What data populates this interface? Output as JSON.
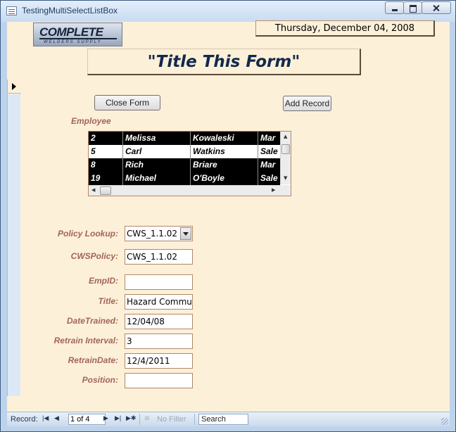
{
  "window": {
    "title": "TestingMultiSelectListBox"
  },
  "logo": {
    "main": "COMPLETE",
    "sub": "WELDERS SUPPLY"
  },
  "header": {
    "date": "Thursday, December 04, 2008",
    "form_title": "\"Title This Form\""
  },
  "buttons": {
    "close_form": "Close Form",
    "add_record": "Add Record"
  },
  "employee_list": {
    "label": "Employee",
    "rows": [
      {
        "id": "2",
        "first": "Melissa",
        "last": "Kowaleski",
        "dept": "Mar",
        "selected": true
      },
      {
        "id": "5",
        "first": "Carl",
        "last": "Watkins",
        "dept": "Sale",
        "selected": false
      },
      {
        "id": "8",
        "first": "Rich",
        "last": "Briare",
        "dept": "Mar",
        "selected": true
      },
      {
        "id": "19",
        "first": "Michael",
        "last": "O'Boyle",
        "dept": "Sale",
        "selected": true
      }
    ]
  },
  "fields": {
    "policy_lookup": {
      "label": "Policy Lookup:",
      "value": "CWS_1.1.02"
    },
    "cws_policy": {
      "label": "CWSPolicy:",
      "value": "CWS_1.1.02"
    },
    "emp_id": {
      "label": "EmpID:",
      "value": ""
    },
    "title": {
      "label": "Title:",
      "value": "Hazard Commu"
    },
    "date_trained": {
      "label": "DateTrained:",
      "value": "12/04/08"
    },
    "retrain_interval": {
      "label": "Retrain Interval:",
      "value": "3"
    },
    "retrain_date": {
      "label": "RetrainDate:",
      "value": "12/4/2011"
    },
    "position": {
      "label": "Position:",
      "value": ""
    }
  },
  "status": {
    "record_label": "Record:",
    "record_value": "1 of 4",
    "filter": "No Filter",
    "search": "Search"
  }
}
